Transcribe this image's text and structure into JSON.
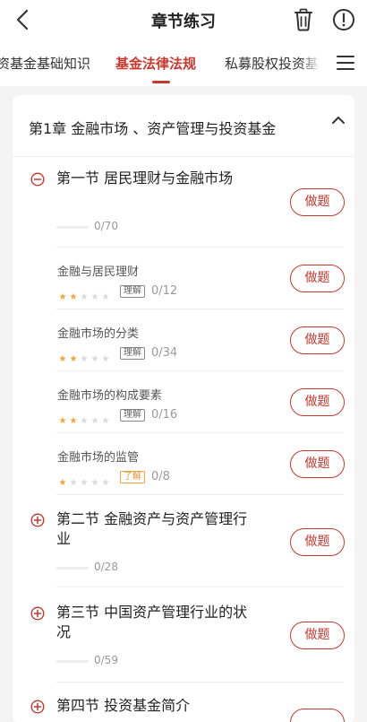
{
  "header": {
    "title": "章节练习",
    "back_icon": "chevron-left-icon",
    "trash_icon": "trash-icon",
    "info_icon": "exclamation-circle-icon"
  },
  "tabs": {
    "items": [
      {
        "label": "资基金基础知识"
      },
      {
        "label": "基金法律法规"
      },
      {
        "label": "私募股权投资基"
      }
    ],
    "active_index": 1,
    "menu_icon": "hamburger-menu-icon",
    "accent_color": "#c8372d"
  },
  "chapter": {
    "title": "第1章 金融市场 、资产管理与投资基金",
    "toggle_icon": "chevron-up-icon",
    "sections": [
      {
        "title": "第一节 居民理财与金融市场",
        "progress": "0/70",
        "action": "做题",
        "expanded": true,
        "icon": "minus-circle-icon",
        "subs": [
          {
            "title": "金融与居民理财",
            "stars": 2,
            "badge": "理解",
            "progress": "0/12",
            "action": "做题"
          },
          {
            "title": "金融市场的分类",
            "stars": 2,
            "badge": "理解",
            "progress": "0/34",
            "action": "做题"
          },
          {
            "title": "金融市场的构成要素",
            "stars": 2,
            "badge": "理解",
            "progress": "0/16",
            "action": "做题"
          },
          {
            "title": "金融市场的监管",
            "stars": 1,
            "badge": "了解",
            "progress": "0/8",
            "action": "做题"
          }
        ]
      },
      {
        "title": "第二节 金融资产与资产管理行业",
        "progress": "0/28",
        "action": "做题",
        "icon": "plus-circle-icon"
      },
      {
        "title": "第三节 中国资产管理行业的状况",
        "progress": "0/59",
        "action": "做题",
        "icon": "plus-circle-icon"
      },
      {
        "title": "第四节 投资基金简介",
        "icon": "plus-circle-icon"
      }
    ]
  }
}
